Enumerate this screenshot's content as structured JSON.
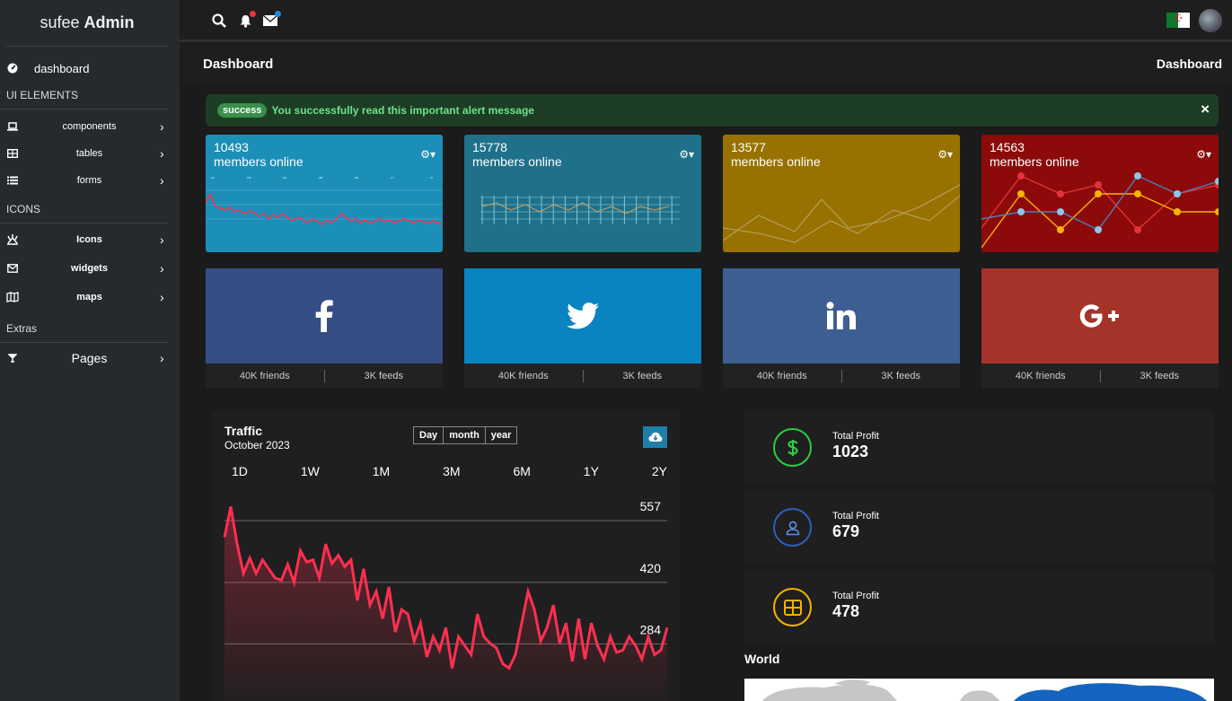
{
  "brand": {
    "name": "sufee",
    "suffix": "Admin"
  },
  "sidebar": {
    "dashboard": "dashboard",
    "sections": [
      {
        "title": "UI ELEMENTS",
        "items": [
          "components",
          "tables",
          "forms"
        ]
      },
      {
        "title": "ICONS",
        "items": [
          "Icons",
          "widgets",
          "maps"
        ]
      },
      {
        "title": "Extras",
        "items": [
          "Pages"
        ]
      }
    ]
  },
  "topbar": {
    "notification_color": "#e53935",
    "mail_color": "#1e88e5"
  },
  "breadcrumb": {
    "title": "Dashboard",
    "current": "Dashboard"
  },
  "alert": {
    "badge": "success",
    "message": "You successfully read this important alert message",
    "close": "×"
  },
  "stat_cards": [
    {
      "value": "10493",
      "label": "members online",
      "color": "#1c8fb8"
    },
    {
      "value": "15778",
      "label": "members online",
      "color": "#1f7089"
    },
    {
      "value": "13577",
      "label": "members online",
      "color": "#987200"
    },
    {
      "value": "14563",
      "label": "members online",
      "color": "#8c0a0a"
    }
  ],
  "social_cards": [
    {
      "network": "facebook",
      "icon": "facebook-icon",
      "color": "#344d85",
      "friends": "40K friends",
      "feeds": "3K feeds"
    },
    {
      "network": "twitter",
      "icon": "twitter-icon",
      "color": "#0a83c1",
      "friends": "40K friends",
      "feeds": "3K feeds"
    },
    {
      "network": "linkedin",
      "icon": "linkedin-icon",
      "color": "#3c5e93",
      "friends": "40K friends",
      "feeds": "3K feeds"
    },
    {
      "network": "google-plus",
      "icon": "google-plus-icon",
      "color": "#a6332a",
      "friends": "40K friends",
      "feeds": "3K feeds"
    }
  ],
  "traffic": {
    "title": "Traffic",
    "subtitle": "October 2023",
    "periods": [
      "Day",
      "month",
      "year"
    ],
    "ranges": [
      "1D",
      "1W",
      "1M",
      "3M",
      "6M",
      "1Y",
      "2Y"
    ]
  },
  "chart_data": {
    "type": "area",
    "color": "#ff2f51",
    "y_ticks": [
      "557",
      "420",
      "284"
    ],
    "y_tick_values": [
      557,
      420,
      284
    ],
    "values": [
      520,
      588,
      505,
      440,
      474,
      440,
      470,
      450,
      430,
      425,
      460,
      420,
      490,
      465,
      470,
      430,
      505,
      462,
      480,
      455,
      470,
      380,
      450,
      370,
      400,
      340,
      410,
      310,
      360,
      350,
      290,
      330,
      255,
      300,
      270,
      320,
      230,
      300,
      280,
      260,
      350,
      300,
      285,
      275,
      240,
      230,
      260,
      330,
      400,
      360,
      290,
      320,
      370,
      285,
      330,
      245,
      340,
      250,
      330,
      280,
      250,
      300,
      265,
      270,
      300,
      280,
      250,
      300,
      260,
      270,
      320
    ]
  },
  "profit_cards": [
    {
      "label": "Total Profit",
      "value": "1023",
      "icon": "dollar-icon",
      "color": "#2ecc40"
    },
    {
      "label": "Total Profit",
      "value": "679",
      "icon": "user-icon",
      "color": "#3b82f6"
    },
    {
      "label": "Total Profit",
      "value": "478",
      "icon": "grid-icon",
      "color": "#f4b400"
    }
  ],
  "world": {
    "title": "World"
  }
}
